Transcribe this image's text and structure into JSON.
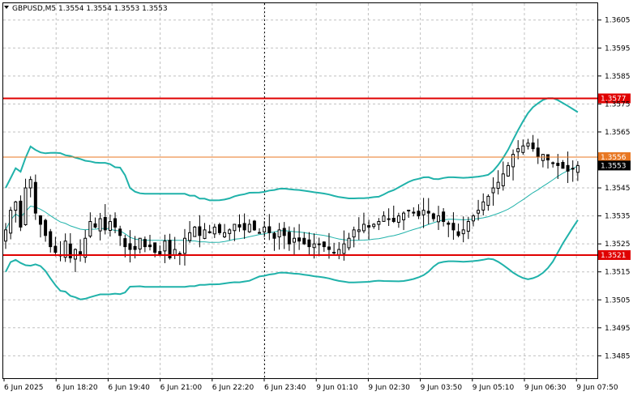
{
  "header": {
    "symbol_line": "GBPUSD,M5  1.3554 1.3554 1.3553 1.3553",
    "collapse_icon": "triangle-down-icon"
  },
  "colors": {
    "background": "#ffffff",
    "grid": "#c0c0c0",
    "candle": "#000000",
    "bands": "#20b2aa",
    "level_red": "#e00000",
    "level_orange": "#e87722",
    "current_price_bg": "#000000"
  },
  "chart_data": {
    "type": "candlestick",
    "title": "GBPUSD,M5",
    "ylim": [
      1.3477,
      1.3611
    ],
    "y_ticks": [
      "1.3605",
      "1.3595",
      "1.3585",
      "1.3575",
      "1.3565",
      "1.3545",
      "1.3535",
      "1.3525",
      "1.3515",
      "1.3505",
      "1.3495",
      "1.3485"
    ],
    "x_ticks": [
      "6 Jun 2025",
      "6 Jun 18:20",
      "6 Jun 19:40",
      "6 Jun 21:00",
      "6 Jun 22:20",
      "6 Jun 23:40",
      "9 Jun 01:10",
      "9 Jun 02:30",
      "9 Jun 03:50",
      "9 Jun 05:10",
      "9 Jun 06:30",
      "9 Jun 07:50"
    ],
    "levels": [
      {
        "value": 1.3577,
        "label": "1.3577",
        "color": "#e00000"
      },
      {
        "value": 1.3556,
        "label": "1.3556",
        "color": "#e87722"
      },
      {
        "value": 1.3521,
        "label": "1.3521",
        "color": "#e00000"
      }
    ],
    "current_price": {
      "value": 1.3553,
      "label": "1.3553"
    },
    "separator_at_tick": 5,
    "candle_count": 116,
    "candle_closes": [
      1.353,
      1.3537,
      1.354,
      1.3531,
      1.3545,
      1.3548,
      1.3536,
      1.3532,
      1.3528,
      1.3524,
      1.3522,
      1.3521,
      1.3526,
      1.352,
      1.3523,
      1.3521,
      1.3527,
      1.3533,
      1.3531,
      1.3534,
      1.353,
      1.3533,
      1.3531,
      1.3528,
      1.3524,
      1.3523,
      1.3523,
      1.3527,
      1.3524,
      1.3524,
      1.3522,
      1.3521,
      1.3526,
      1.352,
      1.3523,
      1.3521,
      1.3527,
      1.3529,
      1.3531,
      1.3528,
      1.353,
      1.3529,
      1.3531,
      1.3529,
      1.3529,
      1.353,
      1.3532,
      1.3531,
      1.353,
      1.3532,
      1.353,
      1.3529,
      1.3531,
      1.3529,
      1.3527,
      1.353,
      1.3528,
      1.3525,
      1.3527,
      1.3526,
      1.3525,
      1.3524,
      1.3525,
      1.3525,
      1.3524,
      1.3523,
      1.3522,
      1.3523,
      1.3525,
      1.3527,
      1.353,
      1.353,
      1.3532,
      1.3531,
      1.3532,
      1.3533,
      1.3535,
      1.3534,
      1.3533,
      1.3535,
      1.3536,
      1.3537,
      1.3536,
      1.3535,
      1.3537,
      1.3536,
      1.3534,
      1.3535,
      1.3533,
      1.3532,
      1.353,
      1.3528,
      1.353,
      1.3533,
      1.3535,
      1.3537,
      1.354,
      1.3542,
      1.3545,
      1.3547,
      1.355,
      1.3553,
      1.3557,
      1.3559,
      1.356,
      1.3561,
      1.3559,
      1.3556,
      1.3557,
      1.3555,
      1.3554,
      1.3553,
      1.3552,
      1.3551,
      1.3552,
      1.3553
    ]
  }
}
